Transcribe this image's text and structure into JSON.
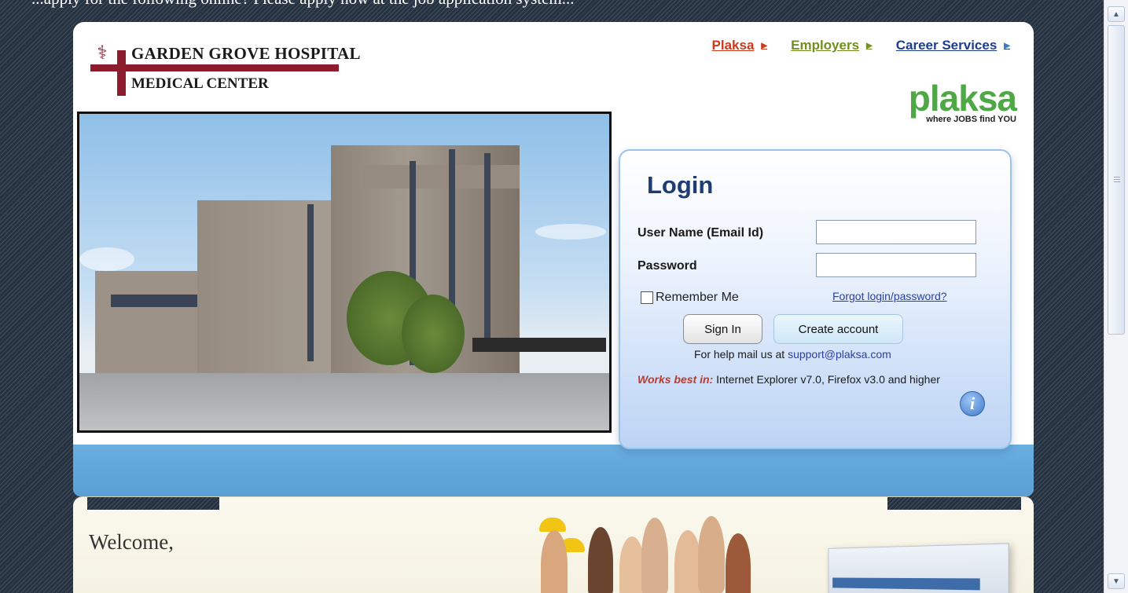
{
  "window": {
    "cutoff_top_text": "...apply for the following online? Please apply now at the job application system..."
  },
  "nav": {
    "links": [
      {
        "label": "Plaksa",
        "color": "#cc3a1a",
        "arrow_color": "#cc3a1a"
      },
      {
        "label": "Employers",
        "color": "#6f8f1e",
        "arrow_color": "#6f8f1e"
      },
      {
        "label": "Career Services",
        "color": "#1f3d8f",
        "arrow_color": "#3a78c9"
      }
    ],
    "arrow_glyph": "▶"
  },
  "hospital_logo": {
    "line1": "GARDEN GROVE HOSPITAL",
    "line2": "MEDICAL CENTER",
    "color": "#8c1c2e"
  },
  "brand": {
    "name": "plaksa",
    "tagline": "where JOBS find YOU",
    "color": "#4fa846"
  },
  "login": {
    "title": "Login",
    "username_label": "User Name (Email Id)",
    "username_value": "",
    "password_label": "Password",
    "password_value": "",
    "remember_label": "Remember Me",
    "remember_checked": false,
    "forgot_label": "Forgot login/password?",
    "signin_label": "Sign In",
    "create_label": "Create account",
    "help_prefix": "For help mail us at ",
    "help_email": "support@plaksa.com",
    "works_label": "Works best in:",
    "works_text": " Internet Explorer v7.0, Firefox v3.0 and higher",
    "info_glyph": "i"
  },
  "welcome": {
    "text": "Welcome,"
  },
  "scrollbar": {
    "up_glyph": "▲",
    "down_glyph": "▼"
  }
}
